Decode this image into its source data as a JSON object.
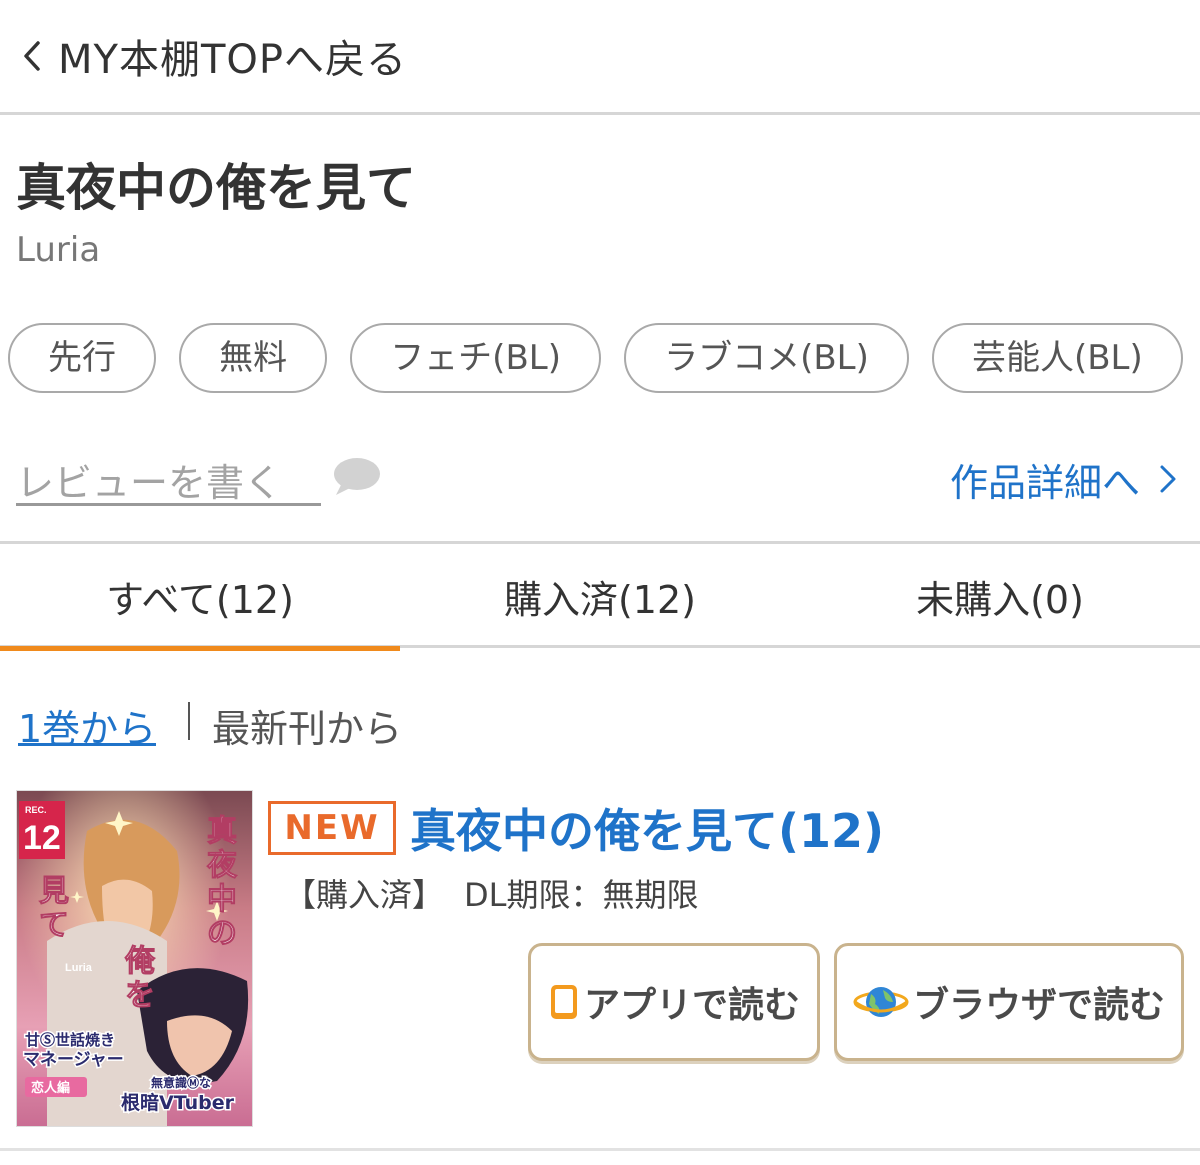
{
  "nav": {
    "back_label": "MY本棚TOPへ戻る"
  },
  "series": {
    "title": "真夜中の俺を見て",
    "author": "Luria"
  },
  "tags": [
    "先行",
    "無料",
    "フェチ(BL)",
    "ラブコメ(BL)",
    "芸能人(BL)"
  ],
  "actions": {
    "review_label": "レビューを書く",
    "detail_label": "作品詳細へ"
  },
  "tabs": [
    {
      "label": "すべて(12)",
      "active": true
    },
    {
      "label": "購入済(12)",
      "active": false
    },
    {
      "label": "未購入(0)",
      "active": false
    }
  ],
  "sort": {
    "first_label": "1巻から",
    "latest_label": "最新刊から"
  },
  "book": {
    "badge": "NEW",
    "title": "真夜中の俺を見て(12)",
    "status": "【購入済】",
    "dl_limit": "DL期限：無期限",
    "app_button": "アプリで読む",
    "browser_button": "ブラウザで読む",
    "cover": {
      "volume_prefix": "REC.",
      "volume": "12",
      "title_vertical": "真夜中の俺を見て",
      "author": "Luria",
      "blurb_1": "甘Ⓢ世話焼き",
      "blurb_2": "マネージャー",
      "blurb_3": "恋人編",
      "blurb_4": "無意識Ⓜな",
      "blurb_5": "根暗VTuber"
    }
  },
  "colors": {
    "link_blue": "#1f73c9",
    "tab_underline_orange": "#f08a1c",
    "new_badge_orange": "#e96a2b",
    "button_border": "#c9b38d"
  }
}
